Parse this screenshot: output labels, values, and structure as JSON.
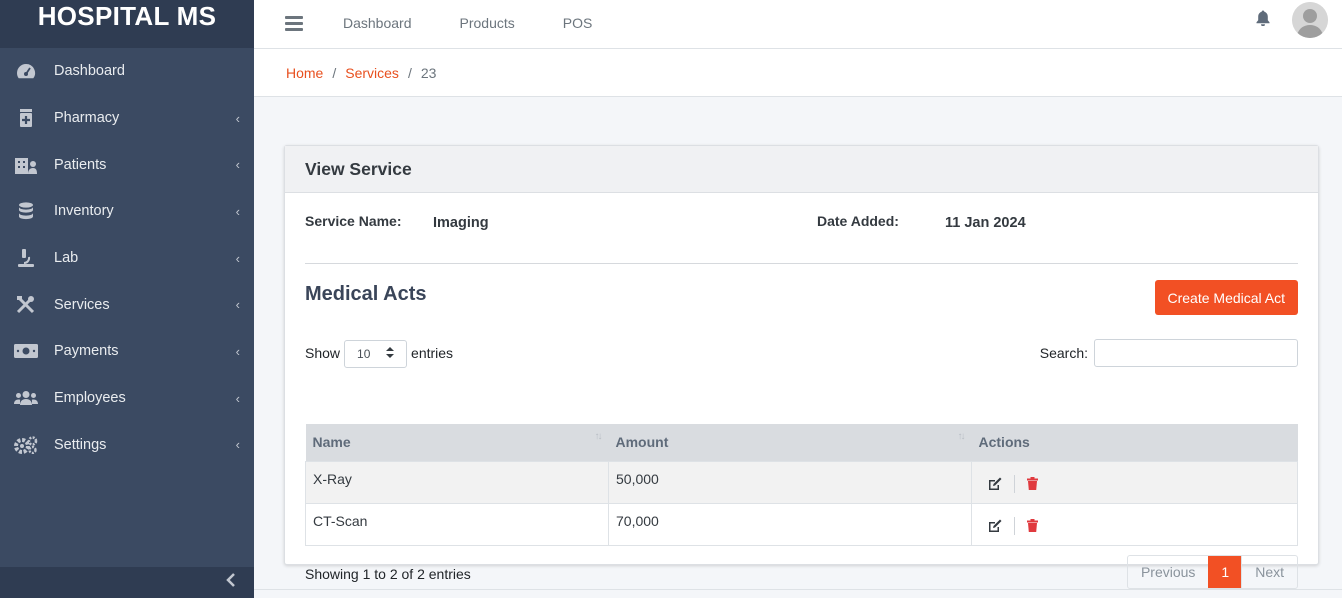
{
  "brand": "HOSPITAL MS",
  "sidebar": {
    "items": [
      {
        "label": "Dashboard",
        "icon": "dashboard-gauge-icon",
        "chevron": ""
      },
      {
        "label": "Pharmacy",
        "icon": "pharmacy-icon",
        "chevron": "‹"
      },
      {
        "label": "Patients",
        "icon": "patients-hospital-icon",
        "chevron": "‹"
      },
      {
        "label": "Inventory",
        "icon": "database-icon",
        "chevron": "‹"
      },
      {
        "label": "Lab",
        "icon": "microscope-icon",
        "chevron": "‹"
      },
      {
        "label": "Services",
        "icon": "tools-icon",
        "chevron": "‹"
      },
      {
        "label": "Payments",
        "icon": "money-icon",
        "chevron": "‹"
      },
      {
        "label": "Employees",
        "icon": "users-icon",
        "chevron": "‹"
      },
      {
        "label": "Settings",
        "icon": "gears-icon",
        "chevron": "‹"
      }
    ],
    "collapse": "‹"
  },
  "topnav": {
    "links": [
      "Dashboard",
      "Products",
      "POS"
    ]
  },
  "breadcrumb": {
    "home": "Home",
    "services": "Services",
    "sep": "/",
    "current": "23"
  },
  "card": {
    "title": "View Service",
    "service_name_label": "Service Name:",
    "service_name": "Imaging",
    "date_label": "Date Added:",
    "date": "11 Jan 2024"
  },
  "medical_acts": {
    "title": "Medical Acts",
    "create_button": "Create Medical Act",
    "show_label": "Show",
    "entries_value": "10",
    "entries_label": "entries",
    "search_label": "Search:",
    "search_value": "",
    "columns": [
      "Name",
      "Amount",
      "Actions"
    ],
    "rows": [
      {
        "name": "X-Ray",
        "amount": "50,000"
      },
      {
        "name": "CT-Scan",
        "amount": "70,000"
      }
    ],
    "info": "Showing 1 to 2 of 2 entries",
    "pager": {
      "previous": "Previous",
      "page": "1",
      "next": "Next"
    }
  },
  "colors": {
    "accent": "#f25024",
    "sidebar_bg": "#3b4a62",
    "brand_bg": "#2f3c52",
    "delete": "#e0393e"
  }
}
